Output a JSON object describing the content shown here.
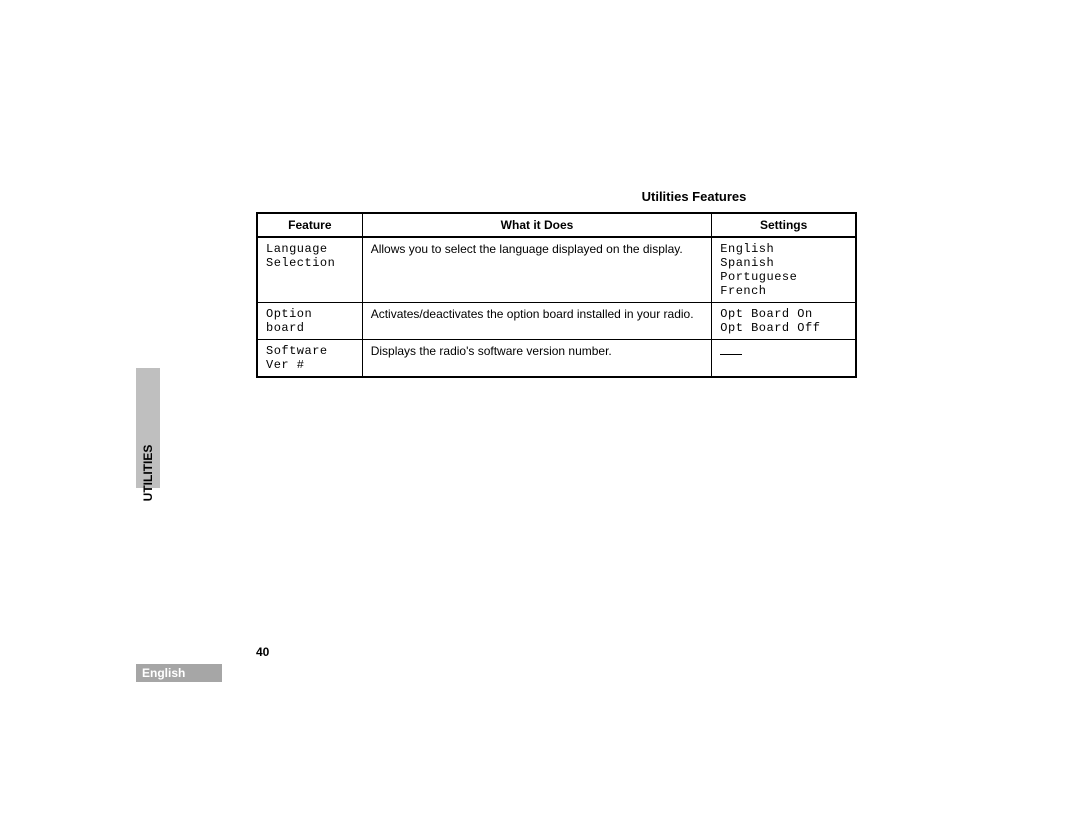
{
  "title": "Utilities Features",
  "sideTab": "UTILITIES",
  "pageNumber": "40",
  "languageBar": "English",
  "table": {
    "headers": {
      "feature": "Feature",
      "desc": "What it Does",
      "settings": "Settings"
    },
    "rows": [
      {
        "feature": "Language\nSelection",
        "desc": "Allows you to select the language displayed on the display.",
        "settings": "English\nSpanish\nPortuguese\nFrench"
      },
      {
        "feature": "Option\nboard",
        "desc": "Activates/deactivates the option board installed in your radio.",
        "settings": "Opt Board On\nOpt Board Off"
      },
      {
        "feature": "Software\nVer #",
        "desc": "Displays the radio's software version number.",
        "settings": null
      }
    ]
  }
}
